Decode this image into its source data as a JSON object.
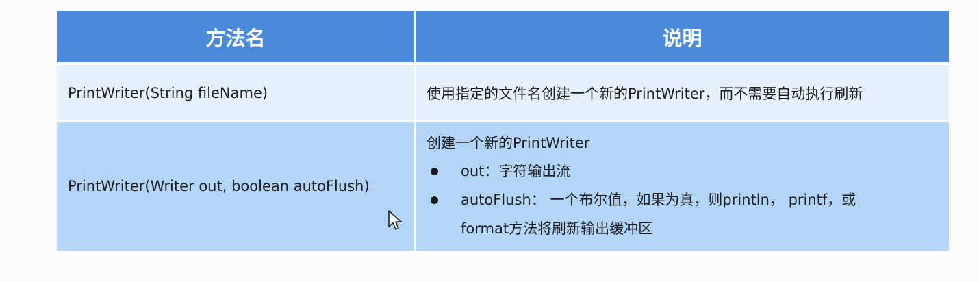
{
  "table": {
    "headers": [
      "方法名",
      "说明"
    ],
    "rows": [
      {
        "method": "PrintWriter(String fileName)",
        "description": "使用指定的文件名创建一个新的PrintWriter，而不需要自动执行刷新"
      },
      {
        "method": "PrintWriter(Writer out, boolean autoFlush)",
        "description_title": "创建一个新的PrintWriter",
        "bullets": [
          "out：字符输出流",
          "autoFlush： 一个布尔值，如果为真，则println， printf，或"
        ],
        "bullet_continuation": "format方法将刷新输出缓冲区"
      }
    ]
  },
  "colors": {
    "header_bg": "#4a8ad8",
    "row1_bg": "#e4f0fb",
    "row2_bg": "#b2d5f8"
  },
  "icons": {
    "cursor": "mouse-pointer-icon",
    "bullet": "bullet-dot-icon"
  }
}
